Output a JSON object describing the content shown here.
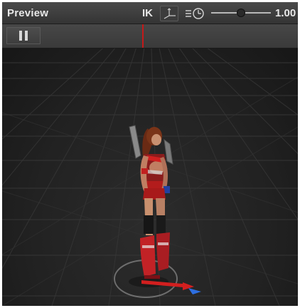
{
  "preview": {
    "title": "Preview",
    "ik_label": "IK",
    "speed_value": "1.00",
    "speed_slider_fraction": 0.5
  },
  "icons": {
    "pivot": "pivot-axes-icon",
    "speed": "playback-speed-clock-icon",
    "pause": "pause-icon"
  },
  "colors": {
    "scrubber": "#c51919",
    "axis_x": "#d21f1f",
    "axis_z": "#2d6ee0"
  }
}
